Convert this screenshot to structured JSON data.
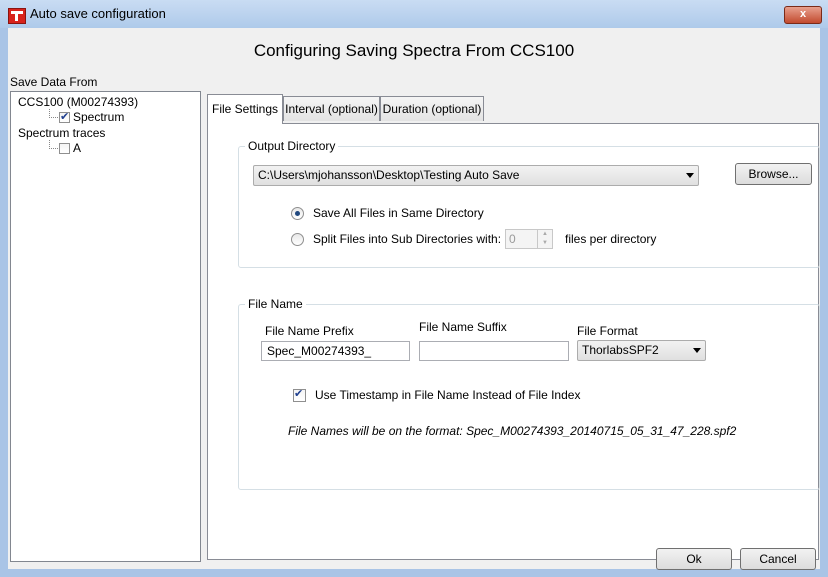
{
  "window": {
    "title": "Auto save configuration",
    "close_glyph": "x",
    "heading": "Configuring Saving Spectra From CCS100"
  },
  "sidebar": {
    "label": "Save Data From",
    "tree": {
      "device": "CCS100 (M00274393)",
      "spectrum": {
        "label": "Spectrum",
        "checked": true
      },
      "traces_header": "Spectrum traces",
      "trace_a": {
        "label": "A",
        "checked": false
      }
    }
  },
  "tabs": [
    {
      "label": "File Settings",
      "active": true
    },
    {
      "label": "Interval (optional)",
      "active": false
    },
    {
      "label": "Duration (optional)",
      "active": false
    }
  ],
  "output_directory": {
    "title": "Output Directory",
    "path": "C:\\Users\\mjohansson\\Desktop\\Testing Auto Save",
    "browse_label": "Browse...",
    "option_same_dir": {
      "label": "Save All Files in Same Directory",
      "selected": true
    },
    "option_split": {
      "label": "Split Files into Sub Directories with:",
      "selected": false
    },
    "files_per_dir_value": "0",
    "files_per_dir_label": "files per directory"
  },
  "file_name": {
    "title": "File Name",
    "prefix_label": "File Name Prefix",
    "prefix_value": "Spec_M00274393_",
    "suffix_label": "File Name Suffix",
    "suffix_value": "",
    "format_label": "File Format",
    "format_value": "ThorlabsSPF2",
    "timestamp_label": "Use Timestamp in File Name Instead of File Index",
    "timestamp_checked": true,
    "format_note": "File Names will be on the format: Spec_M00274393_20140715_05_31_47_228.spf2"
  },
  "footer": {
    "ok_label": "Ok",
    "cancel_label": "Cancel"
  },
  "colors": {
    "frame": "#a9c4e6",
    "client_bg": "#f0f0f0",
    "close_button": "#c24a2e",
    "app_icon": "#d8231c"
  }
}
